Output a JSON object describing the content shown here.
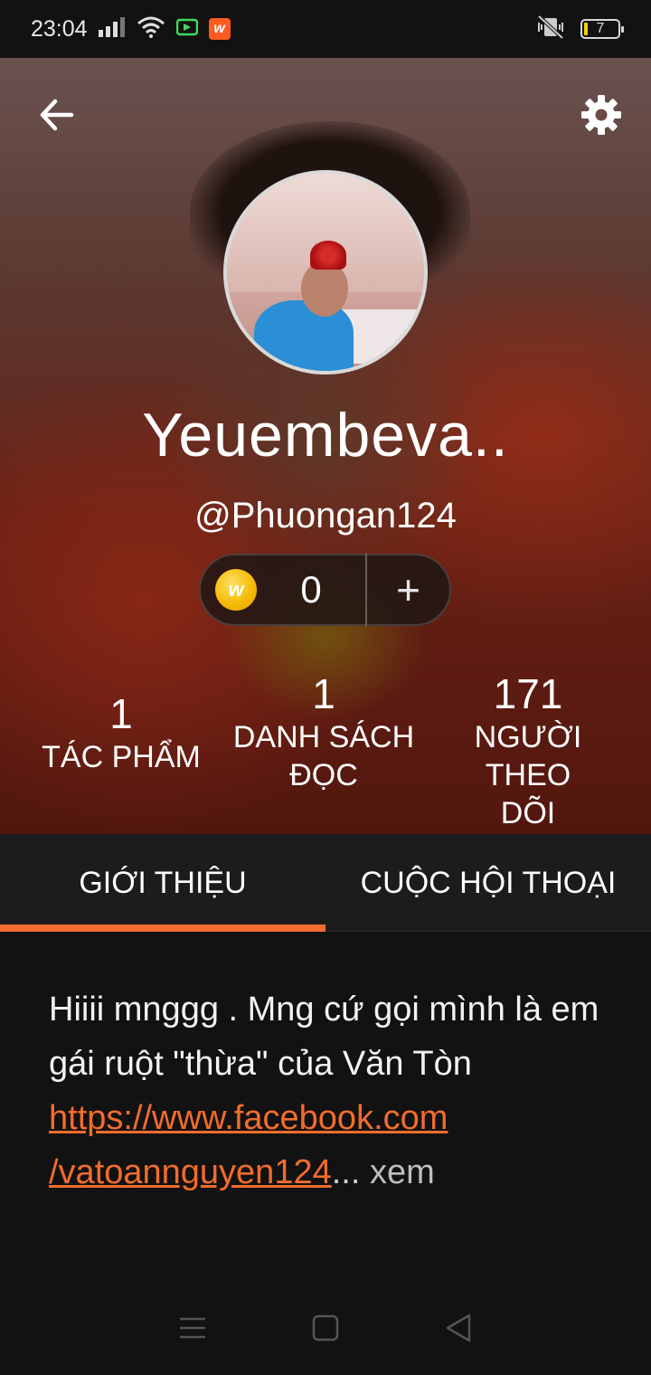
{
  "status_bar": {
    "time": "23:04",
    "battery_level": "7",
    "icons": [
      "signal-icon",
      "wifi-icon",
      "screen-record-icon",
      "wattpad-notification-icon",
      "mute-vibrate-icon",
      "battery-icon"
    ]
  },
  "header": {
    "back_icon": "arrow-left-icon",
    "settings_icon": "gear-icon"
  },
  "profile": {
    "display_name": "Yeuembeva..",
    "handle": "@Phuongan124",
    "coins": "0",
    "coin_add_label": "+"
  },
  "stats": {
    "works_value": "1",
    "works_label": "TÁC PHẨM",
    "reading_lists_value": "1",
    "reading_lists_label_line1": "DANH SÁCH",
    "reading_lists_label_line2": "ĐỌC",
    "followers_value": "171",
    "followers_label_line1": "NGƯỜI THEO",
    "followers_label_line2": "DÕI"
  },
  "tabs": [
    {
      "label": "GIỚI THIỆU",
      "active": true
    },
    {
      "label": "CUỘC HỘI THOẠI",
      "active": false
    }
  ],
  "about": {
    "text": "Hiiii mnggg . Mng cứ gọi mình là em gái ruột \"thừa\" của Văn Tòn",
    "link_line1": "https://www.facebook.com",
    "link_line2": "/vatoannguyen124",
    "ellipsis": "...",
    "more_label": "xem"
  },
  "colors": {
    "accent": "#f26c2d",
    "background": "#121212",
    "tab_bar": "#1c1c1c"
  }
}
